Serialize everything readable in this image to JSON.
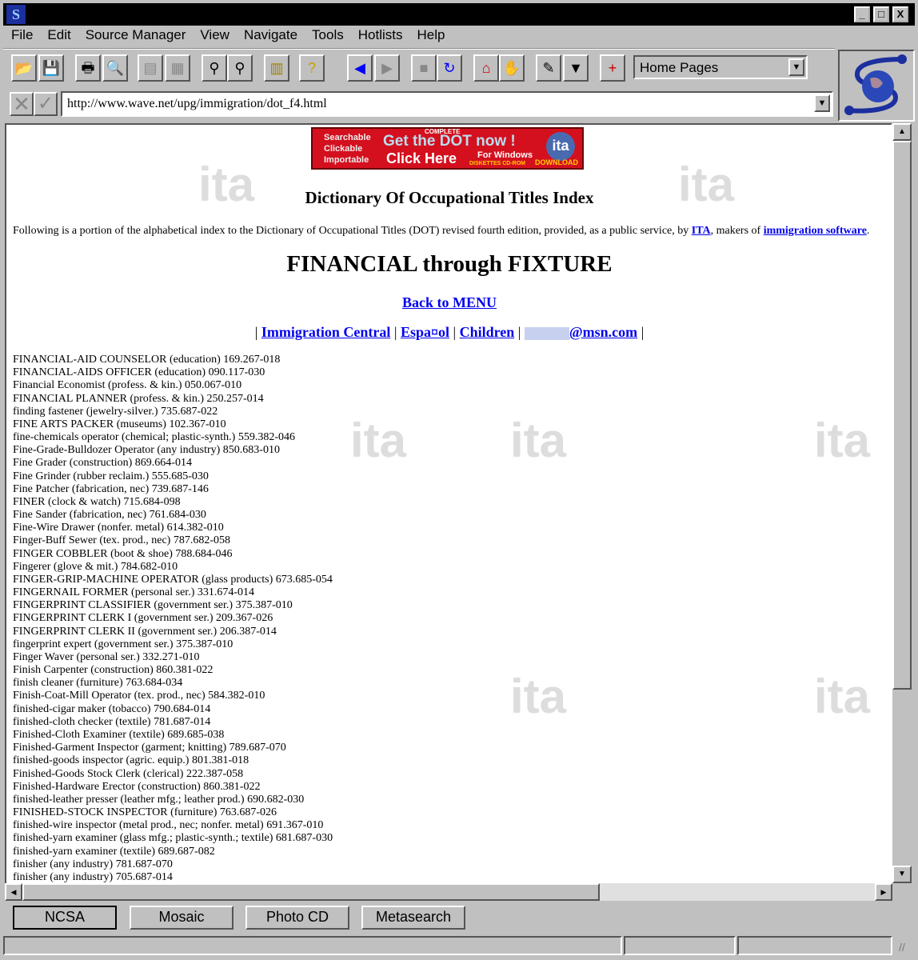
{
  "window": {
    "controls": [
      "_",
      "□",
      "X"
    ]
  },
  "menu": [
    "File",
    "Edit",
    "Source Manager",
    "View",
    "Navigate",
    "Tools",
    "Hotlists",
    "Help"
  ],
  "toolbar": {
    "icons": [
      "open-icon",
      "save-icon",
      "print-icon",
      "print-preview-icon",
      "copy-icon",
      "paste-icon",
      "find-icon",
      "find-next-icon",
      "document-icon",
      "help-icon",
      "back-icon",
      "forward-icon",
      "stop-icon",
      "reload-icon",
      "home-icon",
      "hand-icon",
      "annotate-icon",
      "hotlist-icon",
      "add-hotlist-icon"
    ],
    "glyphs": [
      "📂",
      "💾",
      "🖶",
      "🔍",
      "▤",
      "▦",
      "⚲",
      "⚲",
      "▥",
      "?",
      "◀",
      "▶",
      "■",
      "↻",
      "⌂",
      "✋",
      "✎",
      "▼",
      "+"
    ],
    "colors": [
      "#c8a000",
      "#000080",
      "#000",
      "#000",
      "#888",
      "#888",
      "#000",
      "#000",
      "#a08000",
      "#c8a000",
      "#0000ff",
      "#888",
      "#888",
      "#0000ff",
      "#c00",
      "#888",
      "#000",
      "#000",
      "#c00"
    ],
    "hotlist_combo": "Home Pages"
  },
  "address": {
    "url": "http://www.wave.net/upg/immigration/dot_f4.html"
  },
  "page": {
    "banner": {
      "left": [
        "Searchable",
        "Clickable",
        "Importable"
      ],
      "complete": "COMPLETE",
      "main": "Get the DOT now !",
      "click": "Click Here",
      "windows": "For Windows",
      "media": "DISKETTES  CD-ROM",
      "logo": "ita",
      "download": "DOWNLOAD"
    },
    "title": "Dictionary Of Occupational Titles Index",
    "intro_pre": "Following is a portion of the alphabetical index to the Dictionary of Occupational Titles (DOT) revised fourth edition, provided, as a public service, by ",
    "intro_link1": "ITA",
    "intro_mid": ", makers of ",
    "intro_link2": "immigration software",
    "intro_post": ".",
    "heading": "FINANCIAL through FIXTURE",
    "back_link": "Back to MENU",
    "nav": {
      "sep": "|",
      "links": [
        "Immigration Central",
        "Espa¤ol",
        "Children",
        "@msn.com"
      ]
    },
    "entries": [
      "FINANCIAL-AID COUNSELOR (education) 169.267-018",
      "FINANCIAL-AIDS OFFICER (education) 090.117-030",
      "Financial Economist (profess. & kin.) 050.067-010",
      "FINANCIAL PLANNER (profess. & kin.) 250.257-014",
      "finding fastener (jewelry-silver.) 735.687-022",
      "FINE ARTS PACKER (museums) 102.367-010",
      "fine-chemicals operator (chemical; plastic-synth.) 559.382-046",
      "Fine-Grade-Bulldozer Operator (any industry) 850.683-010",
      "Fine Grader (construction) 869.664-014",
      "Fine Grinder (rubber reclaim.) 555.685-030",
      "Fine Patcher (fabrication, nec) 739.687-146",
      "FINER (clock & watch) 715.684-098",
      "Fine Sander (fabrication, nec) 761.684-030",
      "Fine-Wire Drawer (nonfer. metal) 614.382-010",
      "Finger-Buff Sewer (tex. prod., nec) 787.682-058",
      "FINGER COBBLER (boot & shoe) 788.684-046",
      "Fingerer (glove & mit.) 784.682-010",
      "FINGER-GRIP-MACHINE OPERATOR (glass products) 673.685-054",
      "FINGERNAIL FORMER (personal ser.) 331.674-014",
      "FINGERPRINT CLASSIFIER (government ser.) 375.387-010",
      "FINGERPRINT CLERK I (government ser.) 209.367-026",
      "FINGERPRINT CLERK II (government ser.) 206.387-014",
      "fingerprint expert (government ser.) 375.387-010",
      "Finger Waver (personal ser.) 332.271-010",
      "Finish Carpenter (construction) 860.381-022",
      "finish cleaner (furniture) 763.684-034",
      "Finish-Coat-Mill Operator (tex. prod., nec) 584.382-010",
      "finished-cigar maker (tobacco) 790.684-014",
      "finished-cloth checker (textile) 781.687-014",
      "Finished-Cloth Examiner (textile) 689.685-038",
      "Finished-Garment Inspector (garment; knitting) 789.687-070",
      "finished-goods inspector (agric. equip.) 801.381-018",
      "Finished-Goods Stock Clerk (clerical) 222.387-058",
      "Finished-Hardware Erector (construction) 860.381-022",
      "finished-leather presser (leather mfg.; leather prod.) 690.682-030",
      "FINISHED-STOCK INSPECTOR (furniture) 763.687-026",
      "finished-wire inspector (metal prod., nec; nonfer. metal) 691.367-010",
      "finished-yarn examiner (glass mfg.; plastic-synth.; textile) 681.687-030",
      "finished-yarn examiner (textile) 689.687-082",
      "finisher (any industry) 781.687-070",
      "finisher (any industry) 705.687-014"
    ]
  },
  "bottom_buttons": [
    "NCSA",
    "Mosaic",
    "Photo CD",
    "Metasearch"
  ]
}
